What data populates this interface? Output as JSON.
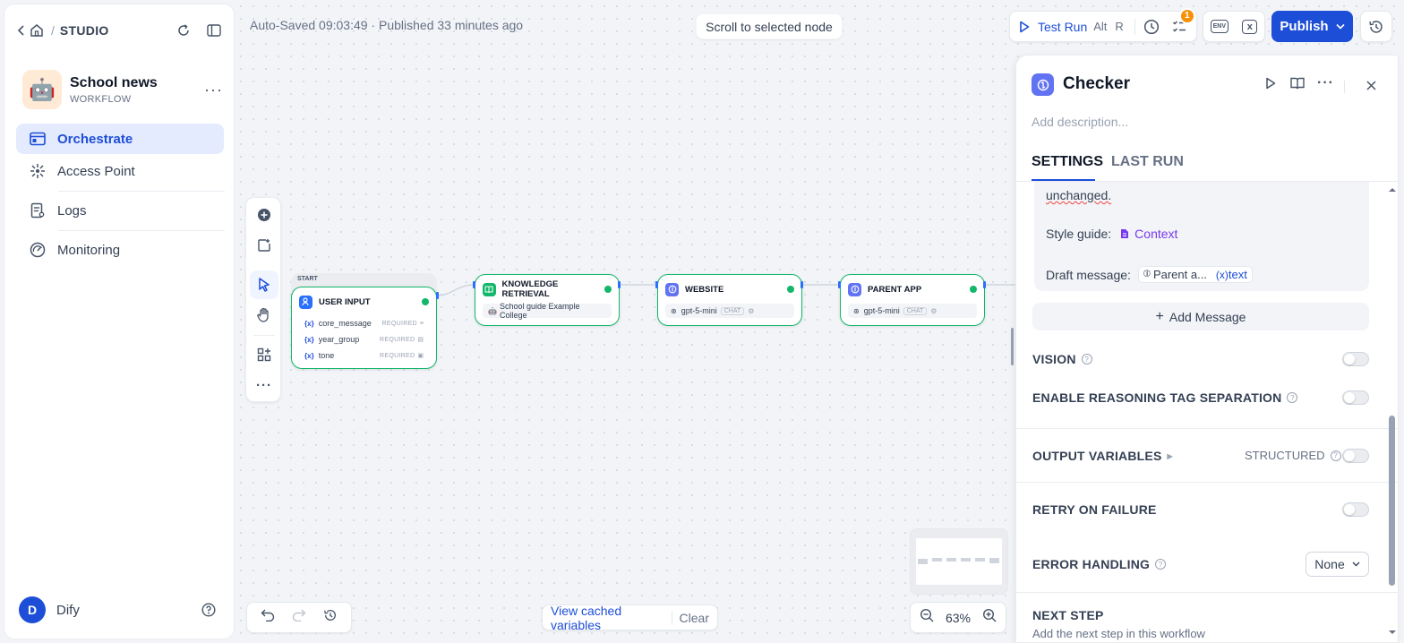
{
  "sidebar": {
    "breadcrumb": "STUDIO",
    "app": {
      "name": "School news",
      "type": "WORKFLOW",
      "emoji": "🤖"
    },
    "nav": [
      {
        "label": "Orchestrate",
        "icon": "layout-icon",
        "active": true
      },
      {
        "label": "Access Point",
        "icon": "access-point-icon",
        "active": false
      },
      {
        "label": "Logs",
        "icon": "logs-icon",
        "active": false
      },
      {
        "label": "Monitoring",
        "icon": "monitoring-icon",
        "active": false
      }
    ],
    "user": {
      "initial": "D",
      "name": "Dify"
    }
  },
  "header": {
    "autosave": "Auto-Saved 09:03:49 · Published 33 minutes ago",
    "scroll_btn": "Scroll to selected node",
    "test_run": "Test Run",
    "shortcut1": "Alt",
    "shortcut2": "R",
    "badge_count": "1",
    "env": "ENV",
    "publish": "Publish"
  },
  "nodes": {
    "start_label": "START",
    "user_input": {
      "title": "USER INPUT",
      "vars": [
        {
          "name": "core_message",
          "req": "REQUIRED"
        },
        {
          "name": "year_group",
          "req": "REQUIRED"
        },
        {
          "name": "tone",
          "req": "REQUIRED"
        }
      ]
    },
    "knowledge": {
      "title": "KNOWLEDGE RETRIEVAL",
      "dataset": "School guide Example College"
    },
    "website": {
      "title": "WEBSITE",
      "model": "gpt-5-mini",
      "tag": "CHAT"
    },
    "parent_app": {
      "title": "PARENT APP",
      "model": "gpt-5-mini",
      "tag": "CHAT"
    }
  },
  "canvas_footer": {
    "view_cached": "View cached variables",
    "clear": "Clear",
    "zoom": "63%"
  },
  "panel": {
    "title": "Checker",
    "description_placeholder": "Add description...",
    "tabs": [
      "SETTINGS",
      "LAST RUN"
    ],
    "prompt": {
      "line1": "unchanged.",
      "style_label": "Style guide:",
      "style_chip": "Context",
      "draft_label": "Draft message:",
      "draft_chip1": "Parent a...",
      "draft_chip2": "text"
    },
    "add_message": "Add Message",
    "vision": "VISION",
    "reasoning": "ENABLE REASONING TAG SEPARATION",
    "output_vars": "OUTPUT VARIABLES",
    "structured": "STRUCTURED",
    "retry": "RETRY ON FAILURE",
    "error_handling": "ERROR HANDLING",
    "error_value": "None",
    "next_step": "NEXT STEP",
    "next_step_desc": "Add the next step in this workflow"
  },
  "colors": {
    "accent": "#1d4ed8",
    "success": "#12b76a",
    "badge": "#f79009"
  }
}
